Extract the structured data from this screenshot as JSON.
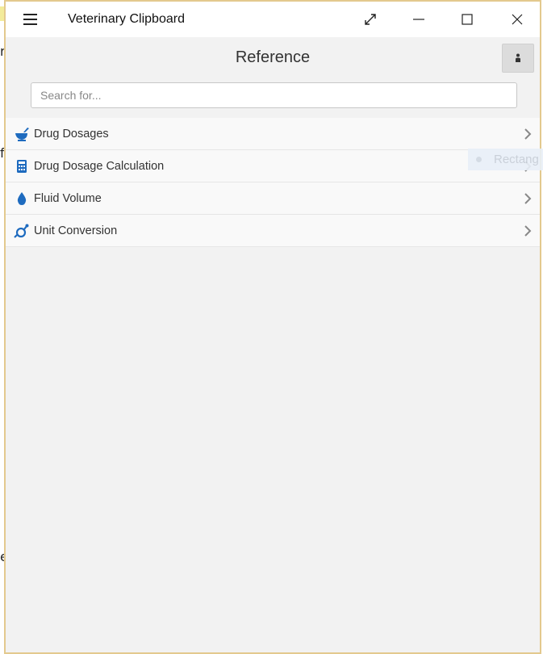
{
  "window": {
    "title": "Veterinary Clipboard"
  },
  "page": {
    "title": "Reference"
  },
  "search": {
    "placeholder": "Search for..."
  },
  "list": {
    "items": [
      {
        "label": "Drug Dosages",
        "icon": "mortar-pestle-icon"
      },
      {
        "label": "Drug Dosage Calculation",
        "icon": "calculator-icon"
      },
      {
        "label": "Fluid Volume",
        "icon": "drop-icon"
      },
      {
        "label": "Unit Conversion",
        "icon": "stethoscope-icon"
      }
    ]
  },
  "overlay": {
    "fragment_text": "Rectang"
  },
  "background": {
    "fragments": [
      "r",
      "f",
      "e"
    ]
  },
  "colors": {
    "accent": "#1e6bbf",
    "window_border": "#e3c98e",
    "background": "#f2f2f2"
  }
}
